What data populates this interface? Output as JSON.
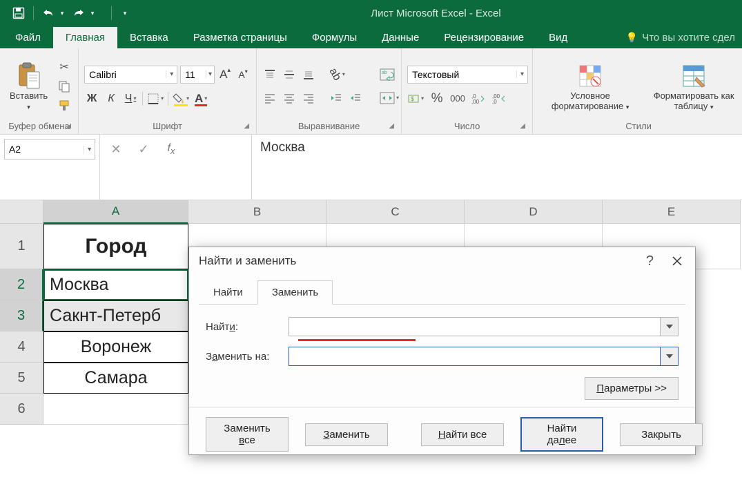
{
  "app": {
    "title": "Лист Microsoft Excel - Excel"
  },
  "qat": {
    "save": "save",
    "undo": "undo",
    "redo": "redo"
  },
  "tabs": {
    "file": "Файл",
    "home": "Главная",
    "insert": "Вставка",
    "layout": "Разметка страницы",
    "formulas": "Формулы",
    "data": "Данные",
    "review": "Рецензирование",
    "view": "Вид",
    "tellme": "Что вы хотите сдел"
  },
  "ribbon": {
    "clipboard": {
      "paste": "Вставить",
      "group": "Буфер обмена"
    },
    "font": {
      "group": "Шрифт",
      "name": "Calibri",
      "size": "11",
      "bold": "Ж",
      "italic": "К",
      "underline": "Ч"
    },
    "align": {
      "group": "Выравнивание"
    },
    "number": {
      "group": "Число",
      "format": "Текстовый",
      "percent": "%",
      "thousands": "000"
    },
    "styles": {
      "group": "Стили",
      "conditional": "Условное форматирование",
      "table": "Форматировать как таблицу"
    }
  },
  "namebox": {
    "value": "A2"
  },
  "formulabar": {
    "value": "Москва"
  },
  "grid": {
    "columns": [
      "A",
      "B",
      "C",
      "D",
      "E"
    ],
    "rows": [
      "1",
      "2",
      "3",
      "4",
      "5",
      "6"
    ],
    "colA": {
      "header": "Город",
      "r2": "Москва",
      "r3": "Сакнт-Петерб",
      "r4": "Воронеж",
      "r5": "Самара"
    }
  },
  "dialog": {
    "title": "Найти и заменить",
    "tab_find": "Найти",
    "tab_replace": "Заменить",
    "find_label_pre": "Найт",
    "find_label_u": "и",
    "find_label_post": ":",
    "find_value": "",
    "replace_label_pre": "З",
    "replace_label_u": "а",
    "replace_label_post": "менить на:",
    "replace_value": "",
    "params_pre": "",
    "params_u": "П",
    "params_post": "араметры >>",
    "replace_all_pre": "Заменить ",
    "replace_all_u": "в",
    "replace_all_post": "се",
    "replace_btn_u": "З",
    "replace_btn_post": "аменить",
    "find_all_u": "Н",
    "find_all_post": "айти все",
    "find_next_pre": "Найти да",
    "find_next_u": "л",
    "find_next_post": "ее",
    "close": "Закрыть"
  }
}
